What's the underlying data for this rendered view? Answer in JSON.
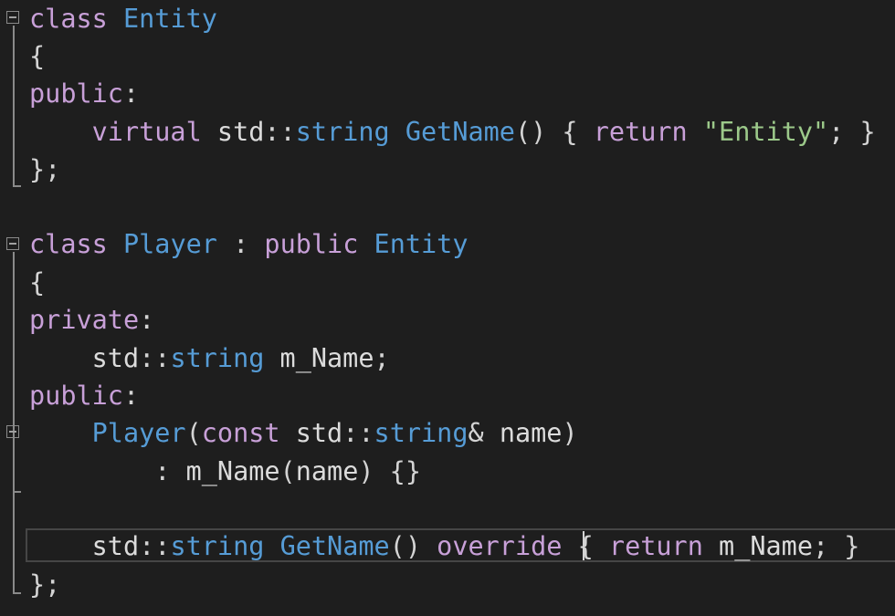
{
  "colors": {
    "background": "#1e1e1e",
    "keyword": "#c8a0d8",
    "type": "#569cd6",
    "string_literal": "#9cc98a",
    "default_text": "#dcdcdc",
    "punctuation": "#d4d4d4"
  },
  "icons": {
    "fold": "collapse-box-minus-icon"
  },
  "editor": {
    "lines": [
      [
        {
          "t": "class",
          "c": "kw"
        },
        {
          "t": " "
        },
        {
          "t": "Entity",
          "c": "ty"
        }
      ],
      [
        {
          "t": "{",
          "c": "pu"
        }
      ],
      [
        {
          "t": "public",
          "c": "kw"
        },
        {
          "t": ":",
          "c": "pu"
        }
      ],
      [
        {
          "t": "    "
        },
        {
          "t": "virtual",
          "c": "kw"
        },
        {
          "t": " std"
        },
        {
          "t": "::",
          "c": "pu"
        },
        {
          "t": "string",
          "c": "ty"
        },
        {
          "t": " "
        },
        {
          "t": "GetName",
          "c": "ty"
        },
        {
          "t": "() { ",
          "c": "pu"
        },
        {
          "t": "return",
          "c": "kw"
        },
        {
          "t": " "
        },
        {
          "t": "\"Entity\"",
          "c": "st"
        },
        {
          "t": "; }",
          "c": "pu"
        }
      ],
      [
        {
          "t": "};",
          "c": "pu"
        }
      ],
      [],
      [
        {
          "t": "class",
          "c": "kw"
        },
        {
          "t": " "
        },
        {
          "t": "Player",
          "c": "ty"
        },
        {
          "t": " : ",
          "c": "pu"
        },
        {
          "t": "public",
          "c": "kw"
        },
        {
          "t": " "
        },
        {
          "t": "Entity",
          "c": "ty"
        }
      ],
      [
        {
          "t": "{",
          "c": "pu"
        }
      ],
      [
        {
          "t": "private",
          "c": "kw"
        },
        {
          "t": ":",
          "c": "pu"
        }
      ],
      [
        {
          "t": "    std"
        },
        {
          "t": "::",
          "c": "pu"
        },
        {
          "t": "string",
          "c": "ty"
        },
        {
          "t": " m_Name"
        },
        {
          "t": ";",
          "c": "pu"
        }
      ],
      [
        {
          "t": "public",
          "c": "kw"
        },
        {
          "t": ":",
          "c": "pu"
        }
      ],
      [
        {
          "t": "    "
        },
        {
          "t": "Player",
          "c": "ty"
        },
        {
          "t": "(",
          "c": "pu"
        },
        {
          "t": "const",
          "c": "kw"
        },
        {
          "t": " std"
        },
        {
          "t": "::",
          "c": "pu"
        },
        {
          "t": "string",
          "c": "ty"
        },
        {
          "t": "&",
          "c": "pu"
        },
        {
          "t": " name"
        },
        {
          "t": ")",
          "c": "pu"
        }
      ],
      [
        {
          "t": "        : ",
          "c": "pu"
        },
        {
          "t": "m_Name"
        },
        {
          "t": "(",
          "c": "pu"
        },
        {
          "t": "name"
        },
        {
          "t": ") {}",
          "c": "pu"
        }
      ],
      [],
      [
        {
          "t": "    std"
        },
        {
          "t": "::",
          "c": "pu"
        },
        {
          "t": "string",
          "c": "ty"
        },
        {
          "t": " "
        },
        {
          "t": "GetName",
          "c": "ty"
        },
        {
          "t": "() ",
          "c": "pu"
        },
        {
          "t": "override",
          "c": "kw"
        },
        {
          "t": " { ",
          "c": "pu"
        },
        {
          "t": "return",
          "c": "kw"
        },
        {
          "t": " m_Name"
        },
        {
          "t": "; }",
          "c": "pu"
        }
      ],
      [
        {
          "t": "};",
          "c": "pu"
        }
      ]
    ]
  }
}
